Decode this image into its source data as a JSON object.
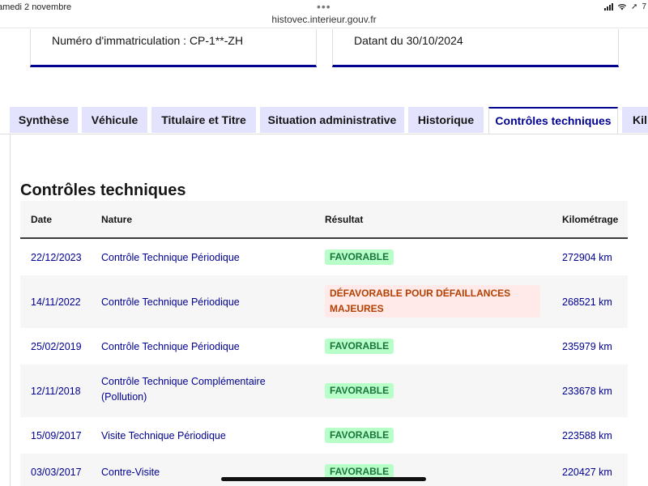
{
  "statusbar": {
    "time": "amedi 2 novembre",
    "battery": "7"
  },
  "browser": {
    "url": "histovec.interieur.gouv.fr"
  },
  "cards": {
    "registration": "Numéro d'immatriculation : CP-1**-ZH",
    "date": "Datant du 30/10/2024"
  },
  "tabs": [
    {
      "label": "Synthèse"
    },
    {
      "label": "Véhicule"
    },
    {
      "label": "Titulaire et Titre"
    },
    {
      "label": "Situation administrative"
    },
    {
      "label": "Historique"
    },
    {
      "label": "Contrôles techniques"
    },
    {
      "label": "Kil"
    }
  ],
  "section": {
    "title": "Contrôles techniques"
  },
  "table": {
    "headers": {
      "date": "Date",
      "nature": "Nature",
      "result": "Résultat",
      "km": "Kilométrage"
    },
    "rows": [
      {
        "date": "22/12/2023",
        "nature": "Contrôle Technique Périodique",
        "result": "FAVORABLE",
        "km": "272904 km"
      },
      {
        "date": "14/11/2022",
        "nature": "Contrôle Technique Périodique",
        "result": "DÉFAVORABLE POUR DÉFAILLANCES MAJEURES",
        "km": "268521 km"
      },
      {
        "date": "25/02/2019",
        "nature": "Contrôle Technique Périodique",
        "result": "FAVORABLE",
        "km": "235979 km"
      },
      {
        "date": "12/11/2018",
        "nature": "Contrôle Technique Complémentaire (Pollution)",
        "result": "FAVORABLE",
        "km": "233678 km"
      },
      {
        "date": "15/09/2017",
        "nature": "Visite Technique Périodique",
        "result": "FAVORABLE",
        "km": "223588 km"
      },
      {
        "date": "03/03/2017",
        "nature": "Contre-Visite",
        "result": "FAVORABLE",
        "km": "220427 km"
      }
    ]
  },
  "colors": {
    "brand_blue": "#000091",
    "favorable_bg": "#b8fec9",
    "favorable_text": "#18753c",
    "defavorable_bg": "#ffe9e9",
    "defavorable_text": "#b34000",
    "tab_bg": "#e3e3fd"
  }
}
